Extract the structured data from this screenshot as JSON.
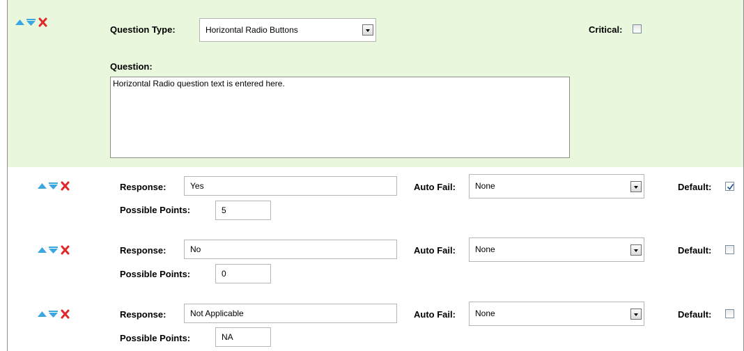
{
  "question": {
    "type_label": "Question Type:",
    "type_value": "Horizontal Radio Buttons",
    "critical_label": "Critical:",
    "critical_checked": false,
    "question_label": "Question:",
    "question_text": "Horizontal Radio question text is entered here."
  },
  "colors": {
    "panel_background": "#e9f8dc",
    "arrow_blue": "#3aa6e2",
    "delete_red": "#e0282a",
    "field_border": "#b5b5b5"
  },
  "responses": [
    {
      "response_label": "Response:",
      "response_value": "Yes",
      "points_label": "Possible Points:",
      "points_value": "5",
      "autofail_label": "Auto Fail:",
      "autofail_value": "None",
      "default_label": "Default:",
      "default_checked": true
    },
    {
      "response_label": "Response:",
      "response_value": "No",
      "points_label": "Possible Points:",
      "points_value": "0",
      "autofail_label": "Auto Fail:",
      "autofail_value": "None",
      "default_label": "Default:",
      "default_checked": false
    },
    {
      "response_label": "Response:",
      "response_value": "Not Applicable",
      "points_label": "Possible Points:",
      "points_value": "NA",
      "autofail_label": "Auto Fail:",
      "autofail_value": "None",
      "default_label": "Default:",
      "default_checked": false
    }
  ]
}
